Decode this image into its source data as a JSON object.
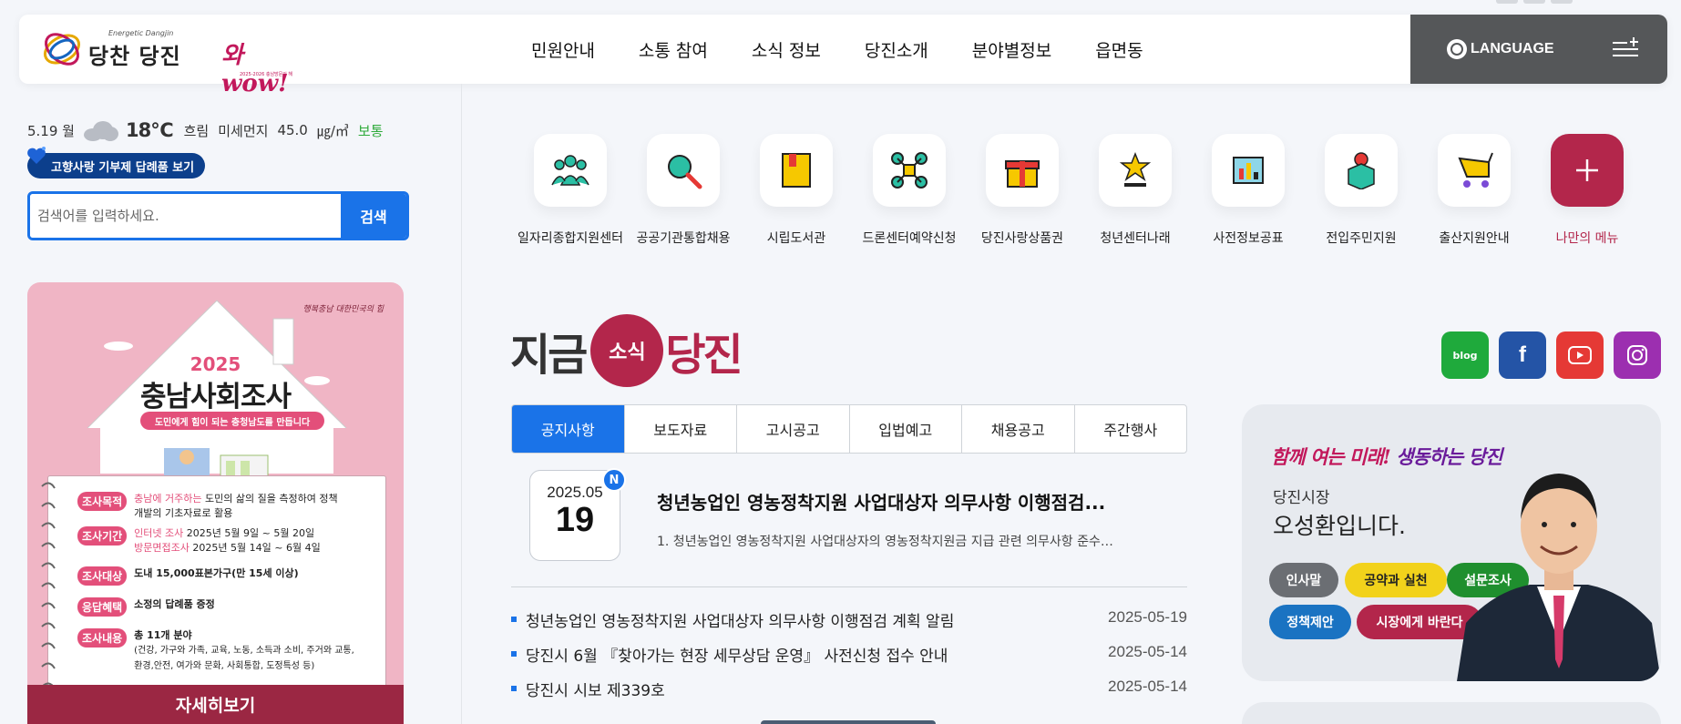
{
  "header": {
    "logo_slogan": "Energetic Dangjin",
    "logo_name": "당찬 당진",
    "logo_wow": "와wow!",
    "logo_wow_sub": "2025-2026 충남방문의 해",
    "nav": [
      "민원안내",
      "소통 참여",
      "소식 정보",
      "당진소개",
      "분야별정보",
      "읍면동"
    ],
    "language_label": "LANGUAGE",
    "colors": {
      "lang_bg": "#555759",
      "brand": "#b3264b",
      "accent": "#1a73e8"
    }
  },
  "weather": {
    "date": "5.19 월",
    "icon": "cloud-icon",
    "temp": "18℃",
    "condition": "흐림",
    "dust_label": "미세먼지",
    "dust_value": "45.0",
    "dust_unit": "㎍/㎥",
    "dust_status": "보통"
  },
  "hometown_badge": "고향사랑 기부제 답례품 보기",
  "search": {
    "placeholder": "검색어를 입력하세요.",
    "button": "검색"
  },
  "banner": {
    "corner_text": "행복충남 대한민국의 힘",
    "year": "2025",
    "title": "충남사회조사",
    "subtitle": "도민에게 힘이 되는 충청남도를 만듭니다",
    "rows": [
      {
        "tag": "조사목적",
        "text_pink": "충남에 거주하는",
        "text": " 도민의 삶의 질을 측정하여 정책",
        "text2": "개발의 기초자료로 활용"
      },
      {
        "tag": "조사기간",
        "text_pink": "인터넷 조사",
        "text": "  2025년 5월 9일 ~ 5월 20일",
        "text_pink2": "방문면접조사",
        "text2": " 2025년 5월 14일 ~ 6월 4일"
      },
      {
        "tag": "조사대상",
        "text": "도내 15,000표본가구(만 15세 이상)"
      },
      {
        "tag": "응답혜택",
        "text": "소정의 답례품 증정"
      },
      {
        "tag": "조사내용",
        "text": "총 11개 분야",
        "text2": "(건강, 가구와 가족,  교육, 노동, 소득과 소비, 주거와 교통,",
        "text3": "환경,안전, 여가와 문화, 사회통합, 도정특성 등)"
      }
    ],
    "detail_button": "자세히보기"
  },
  "quick_menu": [
    {
      "label": "일자리종합지원센터",
      "icon": "people-icon"
    },
    {
      "label": "공공기관통합채용",
      "icon": "magnifier-icon"
    },
    {
      "label": "시립도서관",
      "icon": "book-icon"
    },
    {
      "label": "드론센터예약신청",
      "icon": "drone-icon"
    },
    {
      "label": "당진사랑상품권",
      "icon": "gift-icon"
    },
    {
      "label": "청년센터나래",
      "icon": "star-trophy-icon"
    },
    {
      "label": "사전정보공표",
      "icon": "chart-board-icon"
    },
    {
      "label": "전입주민지원",
      "icon": "box-person-icon"
    },
    {
      "label": "출산지원안내",
      "icon": "stroller-icon"
    },
    {
      "label": "나만의 메뉴",
      "icon": "plus-icon"
    }
  ],
  "news": {
    "title_left": "지금",
    "title_circle": "소식",
    "title_right": "당진",
    "tabs": [
      "공지사항",
      "보도자료",
      "고시공고",
      "입법예고",
      "채용공고",
      "주간행사"
    ],
    "featured": {
      "year_month": "2025.05",
      "day": "19",
      "badge": "N",
      "title": "청년농업인 영농정착지원 사업대상자 의무사항 이행점검...",
      "desc": "1. 청년농업인 영농정착지원 사업대상자의 영농정착지원금 지급 관련 의무사항 준수…"
    },
    "items": [
      {
        "title": "청년농업인 영농정착지원 사업대상자 의무사항 이행점검 계획 알림",
        "date": "2025-05-19"
      },
      {
        "title": "당진시 6월 『찾아가는 현장 세무상담 운영』 사전신청 접수 안내",
        "date": "2025-05-14"
      },
      {
        "title": "당진시 시보 제339호",
        "date": "2025-05-14"
      }
    ]
  },
  "social": [
    {
      "name": "blog",
      "label": "blog",
      "color": "#1faa3c"
    },
    {
      "name": "facebook",
      "label": "f",
      "color": "#2454a6"
    },
    {
      "name": "youtube",
      "label": "▶",
      "color": "#e53935"
    },
    {
      "name": "instagram",
      "label": "◎",
      "color": "#9c2fb0"
    }
  ],
  "mayor": {
    "slogan": "함께 여는 미래! 생동하는 당진",
    "role": "당진시장",
    "name": "오성환입니다.",
    "buttons": [
      {
        "label": "인사말",
        "color": "#6b6e73",
        "text_color": "#ffffff"
      },
      {
        "label": "공약과 실천",
        "color": "#f2d21b",
        "text_color": "#222222"
      },
      {
        "label": "설문조사",
        "color": "#1f8f2e",
        "text_color": "#ffffff"
      },
      {
        "label": "정책제안",
        "color": "#1a73c2",
        "text_color": "#ffffff"
      },
      {
        "label": "시장에게 바란다",
        "color": "#b3264b",
        "text_color": "#ffffff"
      }
    ]
  }
}
